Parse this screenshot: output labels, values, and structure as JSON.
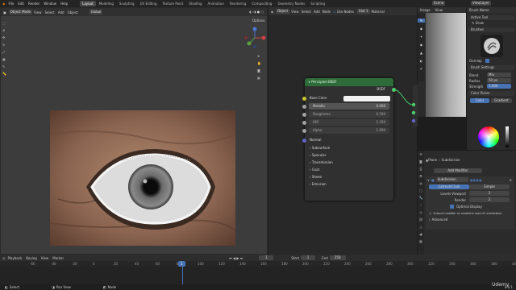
{
  "topbar": {
    "menus": [
      "File",
      "Edit",
      "Render",
      "Window",
      "Help"
    ],
    "workspaces": [
      "Layout",
      "Modeling",
      "Sculpting",
      "UV Editing",
      "Texture Paint",
      "Shading",
      "Animation",
      "Rendering",
      "Compositing",
      "Geometry Nodes",
      "Scripting"
    ],
    "active_workspace": "Layout",
    "scene": "Scene",
    "view_layer": "ViewLayer"
  },
  "viewport": {
    "mode": "Object Mode",
    "menus": [
      "View",
      "Select",
      "Add",
      "Object"
    ],
    "options_label": "Options",
    "global_label": "Global"
  },
  "node_editor": {
    "object": "Object",
    "menus": [
      "View",
      "Select",
      "Add",
      "Node"
    ],
    "use_nodes": "Use Nodes",
    "slot": "Slot 1",
    "material": "Material",
    "node": {
      "title": "Principled BSDF",
      "output": "BSDF",
      "base_color": "Base Color",
      "fields": [
        {
          "label": "Metallic",
          "value": "0.000"
        },
        {
          "label": "Roughness",
          "value": "0.500"
        },
        {
          "label": "IOR",
          "value": "1.450"
        },
        {
          "label": "Alpha",
          "value": "1.000"
        }
      ],
      "normal": "Normal",
      "panels": [
        "Subsurface",
        "Specular",
        "Transmission",
        "Coat",
        "Sheen",
        "Emission"
      ]
    }
  },
  "image_panel": {
    "title": "Image",
    "view": "View"
  },
  "tool_props": {
    "brush_name": "Brush Name",
    "active_tool": "Active Tool",
    "draw": "Draw",
    "brushes": "Brushes",
    "overlap": "Overlap",
    "brush_settings": "Brush Settings",
    "blend_label": "Blend",
    "blend": "Mix",
    "radius_label": "Radius",
    "radius": "50 px",
    "strength_label": "Strength",
    "strength": "1.000",
    "color_picker": "Color Picker",
    "color_tab": "Color",
    "gradient_tab": "Gradient"
  },
  "modifier_panel": {
    "object": "Plane",
    "modifier_name": "Subdivision",
    "add_modifier": "Add Modifier",
    "catmull": "Catmull-Clark",
    "simple": "Simple",
    "levels_viewport_label": "Levels Viewport",
    "levels_viewport": "2",
    "render_label": "Render",
    "render": "2",
    "optimal_display": "Optimal Display",
    "warning": "Subsurf modifier on modeline uses UV subdivision",
    "advanced": "Advanced"
  },
  "timeline": {
    "menus": [
      "Playback",
      "Keying",
      "View",
      "Marker"
    ],
    "frame": "1",
    "start_label": "Start",
    "start": "1",
    "end_label": "End",
    "end": "250",
    "ticks": [
      "-60",
      "-40",
      "-20",
      "0",
      "20",
      "40",
      "60",
      "80",
      "100",
      "120",
      "140",
      "160",
      "180",
      "200",
      "220",
      "240",
      "260",
      "280",
      "300",
      "320",
      "340",
      "360",
      "380",
      "400"
    ],
    "current": "1"
  },
  "statusbar": {
    "select": "Select",
    "pan": "Pan View",
    "context": "Node",
    "version": "4.0.1"
  },
  "watermark": "Udemy",
  "colors": {
    "node_header": "#2e6b3a",
    "accent": "#4772b3"
  }
}
